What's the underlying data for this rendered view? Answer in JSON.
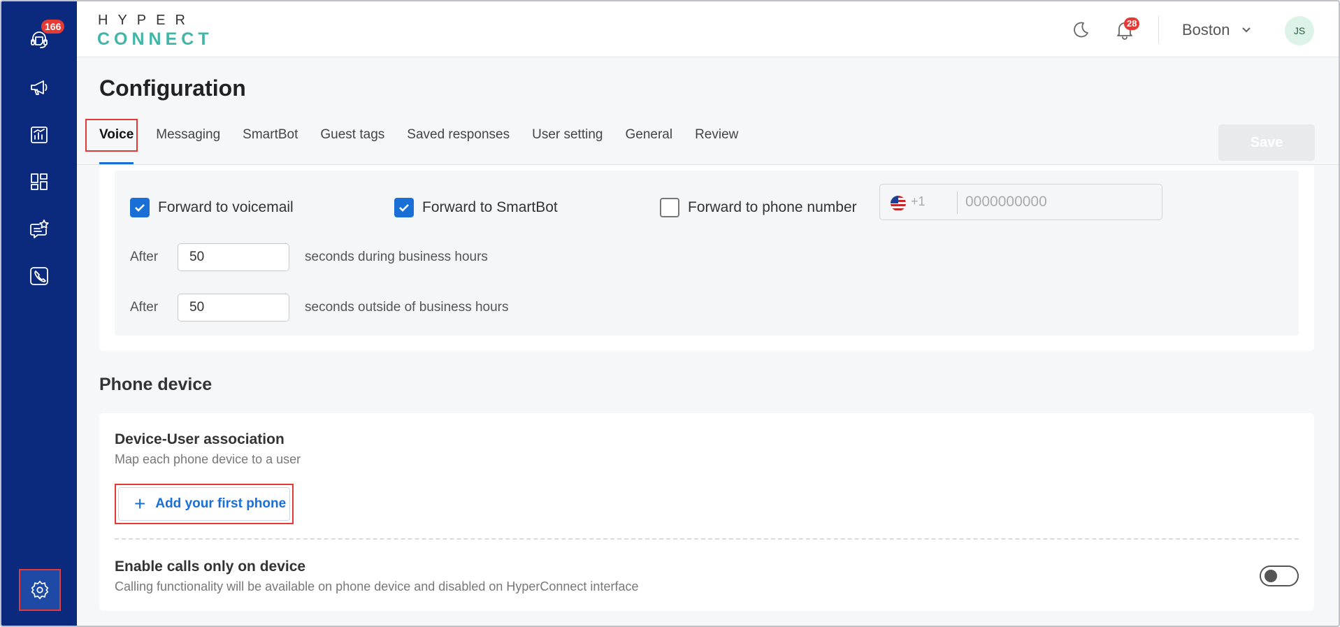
{
  "sidebar": {
    "support_badge": "166",
    "items": [
      "support-agent-icon",
      "megaphone-icon",
      "analytics-icon",
      "dashboard-grid-icon",
      "chat-star-icon",
      "phone-icon"
    ],
    "settings_icon": "gear-icon"
  },
  "header": {
    "logo_top": "HYPER",
    "logo_bottom": "CONNECT",
    "notification_count": "28",
    "location": "Boston",
    "avatar_initials": "JS"
  },
  "page": {
    "title": "Configuration",
    "tabs": [
      "Voice",
      "Messaging",
      "SmartBot",
      "Guest tags",
      "Saved responses",
      "User setting",
      "General",
      "Review"
    ],
    "active_tab": "Voice",
    "save_label": "Save"
  },
  "forwarding": {
    "voicemail": {
      "label": "Forward to voicemail",
      "checked": true
    },
    "smartbot": {
      "label": "Forward to SmartBot",
      "checked": true
    },
    "phone": {
      "label": "Forward to phone number",
      "checked": false
    },
    "country_code": "+1",
    "phone_placeholder": "0000000000",
    "after_label": "After",
    "business_hours_value": "50",
    "business_hours_text": "seconds during business hours",
    "outside_hours_value": "50",
    "outside_hours_text": "seconds outside of business hours"
  },
  "phone_device": {
    "section_title": "Phone device",
    "association_title": "Device-User association",
    "association_subtitle": "Map each phone device to a user",
    "add_button_label": "Add your first phone",
    "enable_title": "Enable calls only on device",
    "enable_subtitle": "Calling functionality will be available on phone device and disabled on HyperConnect interface",
    "enable_toggle_on": false
  },
  "colors": {
    "sidebar": "#0b2a7d",
    "accent": "#1a6fd6",
    "highlight": "#e53935",
    "logo_teal": "#3fb6a8"
  }
}
